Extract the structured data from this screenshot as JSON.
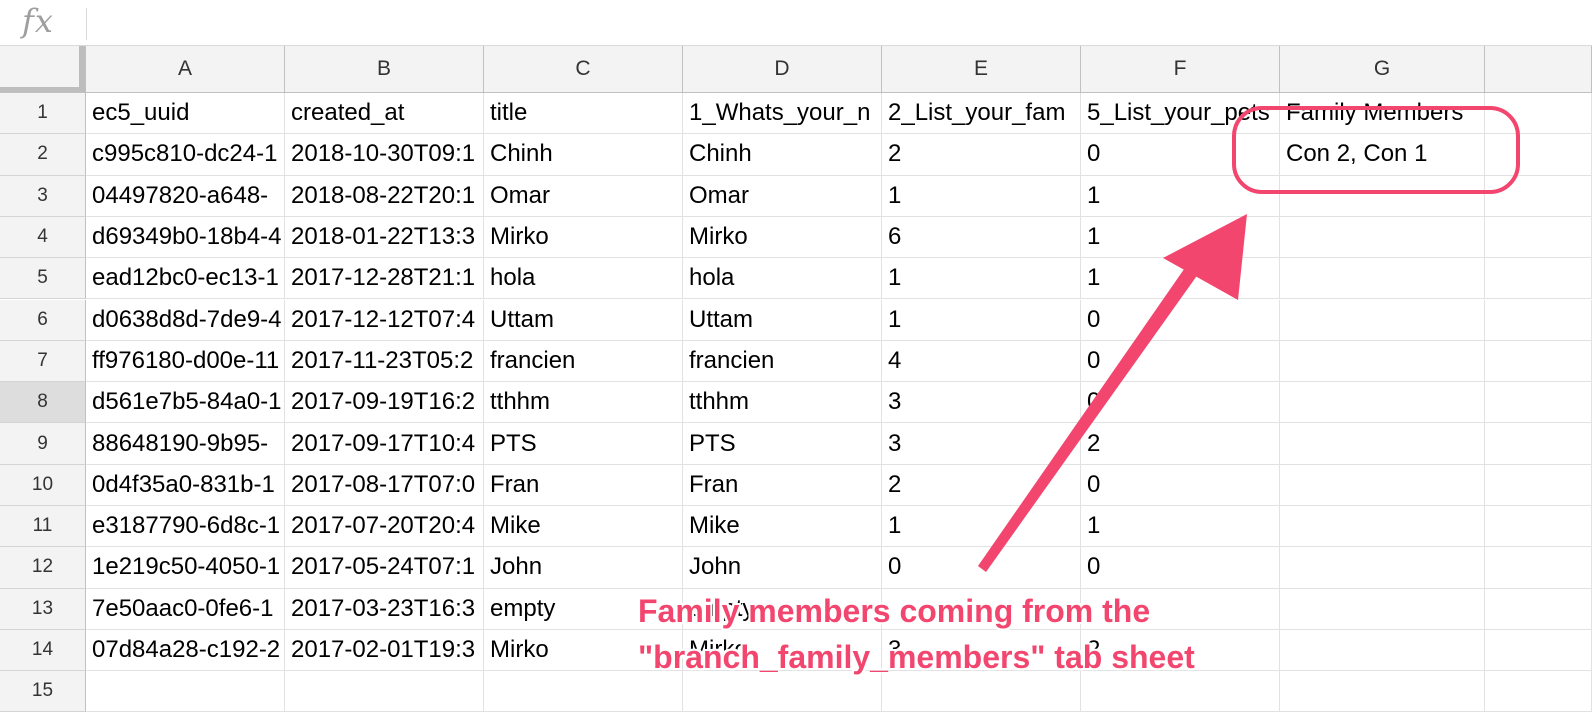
{
  "formula_bar": {
    "icon": "fx-icon",
    "label": "fx",
    "value": ""
  },
  "columns": [
    "A",
    "B",
    "C",
    "D",
    "E",
    "F",
    "G",
    ""
  ],
  "rows": [
    [
      "ec5_uuid",
      "created_at",
      "title",
      "1_Whats_your_n",
      "2_List_your_fam",
      "5_List_your_pets",
      "Family Members",
      ""
    ],
    [
      "c995c810-dc24-1",
      "2018-10-30T09:1",
      "Chinh",
      "Chinh",
      "2",
      "0",
      "Con 2, Con 1",
      ""
    ],
    [
      "04497820-a648-",
      "2018-08-22T20:1",
      "Omar",
      "Omar",
      "1",
      "1",
      "",
      ""
    ],
    [
      "d69349b0-18b4-4",
      "2018-01-22T13:3",
      "Mirko",
      "Mirko",
      "6",
      "1",
      "",
      ""
    ],
    [
      "ead12bc0-ec13-1",
      "2017-12-28T21:1",
      "hola",
      "hola",
      "1",
      "1",
      "",
      ""
    ],
    [
      "d0638d8d-7de9-4",
      "2017-12-12T07:4",
      "Uttam",
      "Uttam",
      "1",
      "0",
      "",
      ""
    ],
    [
      "ff976180-d00e-11",
      "2017-11-23T05:2",
      "francien",
      "francien",
      "4",
      "0",
      "",
      ""
    ],
    [
      "d561e7b5-84a0-1",
      "2017-09-19T16:2",
      "tthhm",
      "tthhm",
      "3",
      "0",
      "",
      ""
    ],
    [
      "88648190-9b95-",
      "2017-09-17T10:4",
      "PTS",
      "PTS",
      "3",
      "2",
      "",
      ""
    ],
    [
      "0d4f35a0-831b-1",
      "2017-08-17T07:0",
      "Fran",
      "Fran",
      "2",
      "0",
      "",
      ""
    ],
    [
      "e3187790-6d8c-1",
      "2017-07-20T20:4",
      "Mike",
      "Mike",
      "1",
      "1",
      "",
      ""
    ],
    [
      "1e219c50-4050-1",
      "2017-05-24T07:1",
      "John",
      "John",
      "0",
      "0",
      "",
      ""
    ],
    [
      "7e50aac0-0fe6-1",
      "2017-03-23T16:3",
      "empty",
      "empty",
      "",
      "",
      "",
      ""
    ],
    [
      "07d84a28-c192-2",
      "2017-02-01T19:3",
      "Mirko",
      "Mirko",
      "3",
      "2",
      "",
      ""
    ],
    [
      "",
      "",
      "",
      "",
      "",
      "",
      "",
      ""
    ]
  ],
  "selected_row": 8,
  "annotation": {
    "line1": "Family members coming from the",
    "line2": "\"branch_family_members\" tab sheet",
    "color": "#f2466f"
  }
}
